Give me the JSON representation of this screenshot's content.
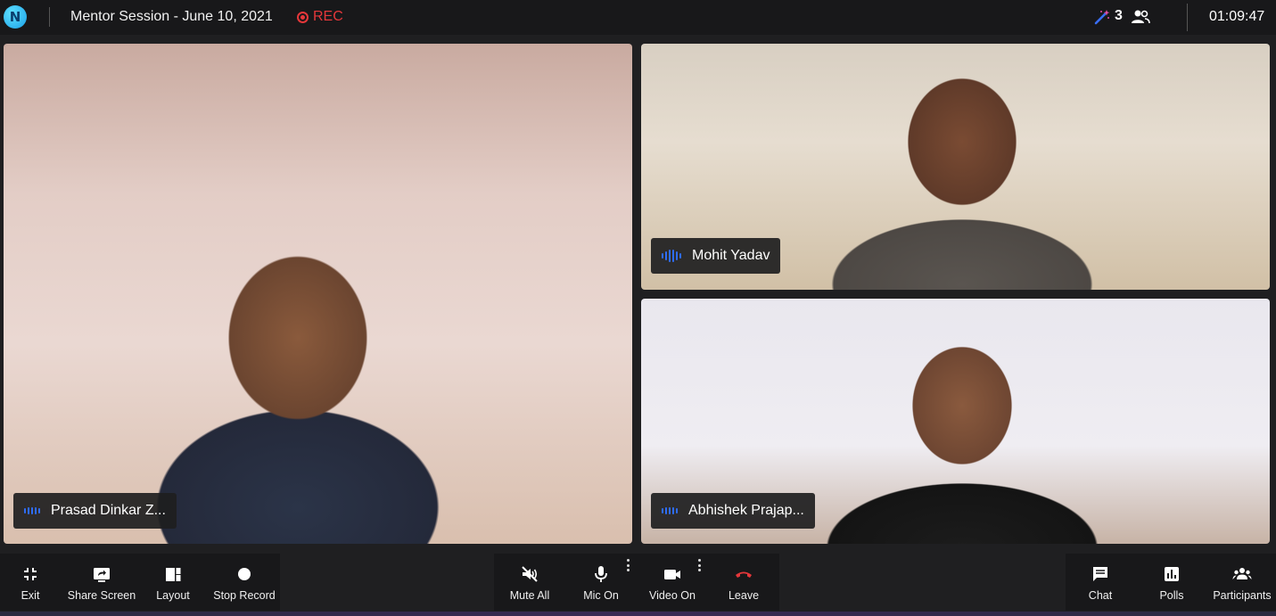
{
  "app": {
    "logo_letter": "N",
    "accent": "#2f6cf5",
    "rec_color": "#e5373a"
  },
  "header": {
    "title": "Mentor Session - June 10, 2021",
    "rec_label": "REC",
    "participant_count": "3",
    "timer": "01:09:47"
  },
  "tiles": [
    {
      "name": "Prasad Dinkar Z..."
    },
    {
      "name": "Mohit Yadav"
    },
    {
      "name": "Abhishek Prajap..."
    }
  ],
  "toolbar": {
    "left": [
      {
        "label": "Exit",
        "icon": "exit-fullscreen-icon"
      },
      {
        "label": "Share Screen",
        "icon": "share-screen-icon"
      },
      {
        "label": "Layout",
        "icon": "layout-icon"
      },
      {
        "label": "Stop Record",
        "icon": "record-dot-icon"
      }
    ],
    "center": [
      {
        "label": "Mute All",
        "icon": "mute-all-icon"
      },
      {
        "label": "Mic On",
        "icon": "mic-icon"
      },
      {
        "label": "Video On",
        "icon": "video-camera-icon"
      },
      {
        "label": "Leave",
        "icon": "leave-phone-icon"
      }
    ],
    "right": [
      {
        "label": "Chat",
        "icon": "chat-icon"
      },
      {
        "label": "Polls",
        "icon": "polls-icon"
      },
      {
        "label": "Participants",
        "icon": "participants-icon"
      }
    ]
  }
}
